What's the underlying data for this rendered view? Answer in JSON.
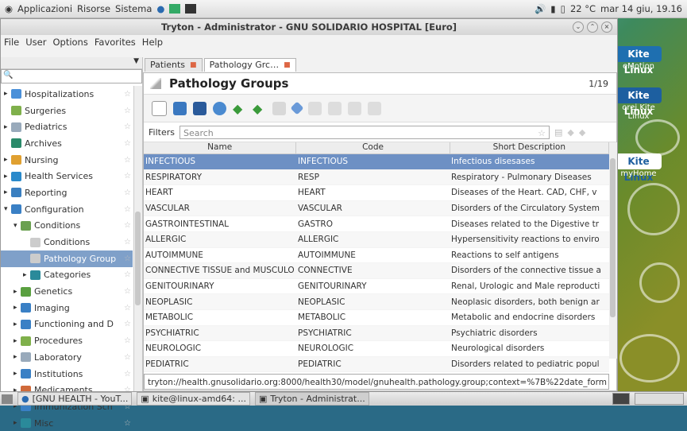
{
  "topbar": {
    "menus": [
      "Applicazioni",
      "Risorse",
      "Sistema"
    ],
    "weather": "22 °C",
    "clock": "mar 14 giu, 19.16"
  },
  "window": {
    "title": "Tryton - Administrator - GNU SOLIDARIO HOSPITAL [Euro]"
  },
  "menubar": [
    "File",
    "User",
    "Options",
    "Favorites",
    "Help"
  ],
  "sidebar": {
    "items": [
      {
        "label": "Hospitalizations",
        "indent": 0,
        "arrow": "▸",
        "color": "#4a90d9"
      },
      {
        "label": "Surgeries",
        "indent": 0,
        "arrow": "",
        "color": "#7fb04b"
      },
      {
        "label": "Pediatrics",
        "indent": 0,
        "arrow": "▸",
        "color": "#9ab"
      },
      {
        "label": "Archives",
        "indent": 0,
        "arrow": "",
        "color": "#2a8a6a"
      },
      {
        "label": "Nursing",
        "indent": 0,
        "arrow": "▸",
        "color": "#e0a030"
      },
      {
        "label": "Health Services",
        "indent": 0,
        "arrow": "▸",
        "color": "#2a8acb"
      },
      {
        "label": "Reporting",
        "indent": 0,
        "arrow": "▸",
        "color": "#3a7fc0"
      },
      {
        "label": "Configuration",
        "indent": 0,
        "arrow": "▾",
        "color": "#3a80c5"
      },
      {
        "label": "Conditions",
        "indent": 1,
        "arrow": "▾",
        "color": "#6aa050"
      },
      {
        "label": "Conditions",
        "indent": 2,
        "arrow": "",
        "color": "#ccc"
      },
      {
        "label": "Pathology Group",
        "indent": 2,
        "arrow": "",
        "color": "#ccc",
        "selected": true
      },
      {
        "label": "Categories",
        "indent": 2,
        "arrow": "▸",
        "color": "#2a8a9a"
      },
      {
        "label": "Genetics",
        "indent": 1,
        "arrow": "▸",
        "color": "#5aa040"
      },
      {
        "label": "Imaging",
        "indent": 1,
        "arrow": "▸",
        "color": "#3a80c5"
      },
      {
        "label": "Functioning and D",
        "indent": 1,
        "arrow": "▸",
        "color": "#3a80c5"
      },
      {
        "label": "Procedures",
        "indent": 1,
        "arrow": "▸",
        "color": "#7fb04b"
      },
      {
        "label": "Laboratory",
        "indent": 1,
        "arrow": "▸",
        "color": "#9ab"
      },
      {
        "label": "Institutions",
        "indent": 1,
        "arrow": "▸",
        "color": "#3a80c5"
      },
      {
        "label": "Medicaments",
        "indent": 1,
        "arrow": "▸",
        "color": "#d06a3a"
      },
      {
        "label": "Immunization Sch",
        "indent": 1,
        "arrow": "▸",
        "color": "#3a80c5"
      },
      {
        "label": "Misc",
        "indent": 1,
        "arrow": "▸",
        "color": "#2a8a9a"
      }
    ]
  },
  "tabs": [
    {
      "label": "Patients"
    },
    {
      "label": "Pathology Grc…",
      "active": true
    }
  ],
  "header": {
    "title": "Pathology Groups",
    "counter": "1/19"
  },
  "filters": {
    "label": "Filters",
    "placeholder": "Search"
  },
  "grid": {
    "columns": [
      "Name",
      "Code",
      "Short Description"
    ],
    "rows": [
      [
        "INFECTIOUS",
        "INFECTIOUS",
        "Infectious disesases"
      ],
      [
        "RESPIRATORY",
        "RESP",
        "Respiratory - Pulmonary Diseases"
      ],
      [
        "HEART",
        "HEART",
        "Diseases of the Heart. CAD, CHF, v"
      ],
      [
        "VASCULAR",
        "VASCULAR",
        "Disorders of the Circulatory System"
      ],
      [
        "GASTROINTESTINAL",
        "GASTRO",
        "Diseases related to the Digestive tr"
      ],
      [
        "ALLERGIC",
        "ALLERGIC",
        "Hypersensitivity reactions to enviro"
      ],
      [
        "AUTOIMMUNE",
        "AUTOIMMUNE",
        "Reactions to self antigens"
      ],
      [
        "CONNECTIVE TISSUE and MUSCULO",
        "CONNECTIVE",
        "Disorders of the connective tissue a"
      ],
      [
        "GENITOURINARY",
        "GENITOURINARY",
        "Renal, Urologic and Male reproducti"
      ],
      [
        "NEOPLASIC",
        "NEOPLASIC",
        "Neoplasic disorders, both benign ar"
      ],
      [
        "METABOLIC",
        "METABOLIC",
        "Metabolic and endocrine disorders"
      ],
      [
        "PSYCHIATRIC",
        "PSYCHIATRIC",
        "Psychiatric disorders"
      ],
      [
        "NEUROLOGIC",
        "NEUROLOGIC",
        "Neurological disorders"
      ],
      [
        "PEDIATRIC",
        "PEDIATRIC",
        "Disorders related to pediatric popul"
      ]
    ]
  },
  "url": "tryton://health.gnusolidario.org:8000/health30/model/gnuhealth.pathology.group;context=%7B%22date_form",
  "taskbar": [
    {
      "label": "[GNU HEALTH - YouT..."
    },
    {
      "label": "kite@linux-amd64: ..."
    },
    {
      "label": "Tryton - Administrat..."
    }
  ],
  "desktop": [
    {
      "logo": "Kite Linux",
      "caption": "eMotion"
    },
    {
      "logo": "Kite Linux",
      "caption": "orei Kite Linux"
    },
    {
      "logo": "Kite Linux",
      "caption": "myHome"
    }
  ]
}
